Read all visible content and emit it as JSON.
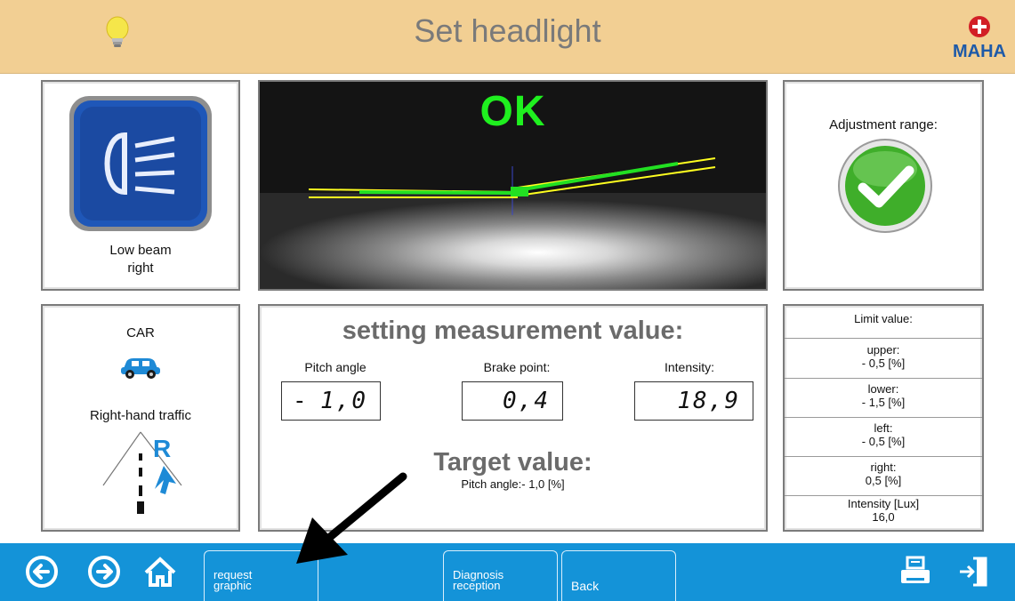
{
  "header": {
    "title": "Set headlight",
    "bulb_icon": "lightbulb-icon",
    "logo_text": "MAHA",
    "background": "#f2cf93"
  },
  "beam_panel": {
    "icon": "low-beam-headlight-icon",
    "label_line1": "Low beam",
    "label_line2": "right"
  },
  "camera_panel": {
    "status_text": "OK",
    "status_color": "#1ff01f"
  },
  "adjustment_panel": {
    "label": "Adjustment range:",
    "icon": "check-circle-icon",
    "status_color": "#3fae2a"
  },
  "vehicle_panel": {
    "vehicle_type": "CAR",
    "vehicle_icon": "car-icon",
    "traffic_label": "Right-hand traffic",
    "traffic_icon": "right-hand-traffic-icon",
    "traffic_letter": "R"
  },
  "measurement_panel": {
    "title": "setting measurement value:",
    "pitch_label": "Pitch angle",
    "pitch_sign": "-",
    "pitch_value": "1,0",
    "brake_label": "Brake point:",
    "brake_value": "0,4",
    "intensity_label": "Intensity:",
    "intensity_value": "18,9",
    "target_title": "Target value:",
    "target_text": "Pitch angle:- 1,0 [%]"
  },
  "limit_panel": {
    "title": "Limit value:",
    "rows": [
      {
        "label": "upper:",
        "value": "- 0,5 [%]"
      },
      {
        "label": "lower:",
        "value": "- 1,5 [%]"
      },
      {
        "label": "left:",
        "value": "- 0,5 [%]"
      },
      {
        "label": "right:",
        "value": "0,5 [%]"
      },
      {
        "label": "Intensity [Lux]",
        "value": "16,0"
      }
    ]
  },
  "footer": {
    "background": "#1493d8",
    "back_icon": "arrow-left-circle-icon",
    "forward_icon": "arrow-right-circle-icon",
    "home_icon": "home-icon",
    "request_graphic_line1": "request",
    "request_graphic_line2": "graphic",
    "diagnosis_line1": "Diagnosis",
    "diagnosis_line2": "reception",
    "back_label": "Back",
    "print_icon": "printer-icon",
    "exit_icon": "exit-door-icon"
  }
}
